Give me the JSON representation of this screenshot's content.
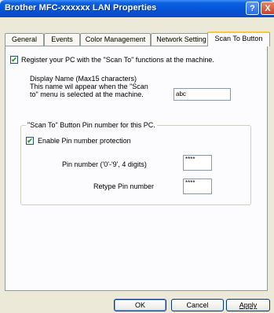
{
  "window": {
    "title": "Brother MFC-xxxxxx  LAN Properties",
    "help": "?",
    "close": "X"
  },
  "tabs": [
    {
      "label": "General"
    },
    {
      "label": "Events"
    },
    {
      "label": "Color Management"
    },
    {
      "label": "Network Setting"
    },
    {
      "label": "Scan To Button",
      "active": true
    }
  ],
  "panel": {
    "register_label": "Register your PC with the \"Scan To\" functions at the machine.",
    "register_checked": true,
    "display_name_line1": "Display Name (Max15 characters)",
    "display_name_line2": "This name wil appear when the \"Scan",
    "display_name_line3": "to\" menu is selected at the machine.",
    "display_name_value": "abc",
    "group_title": "\"Scan To\" Button Pin number for this PC.",
    "enable_pin_label": "Enable Pin number protection",
    "enable_pin_checked": true,
    "pin_label": "Pin number ('0'-'9', 4 digits)",
    "pin_value": "****",
    "retype_label": "Retype Pin number",
    "retype_value": "****"
  },
  "buttons": {
    "ok": "OK",
    "cancel": "Cancel",
    "apply": "Apply"
  }
}
